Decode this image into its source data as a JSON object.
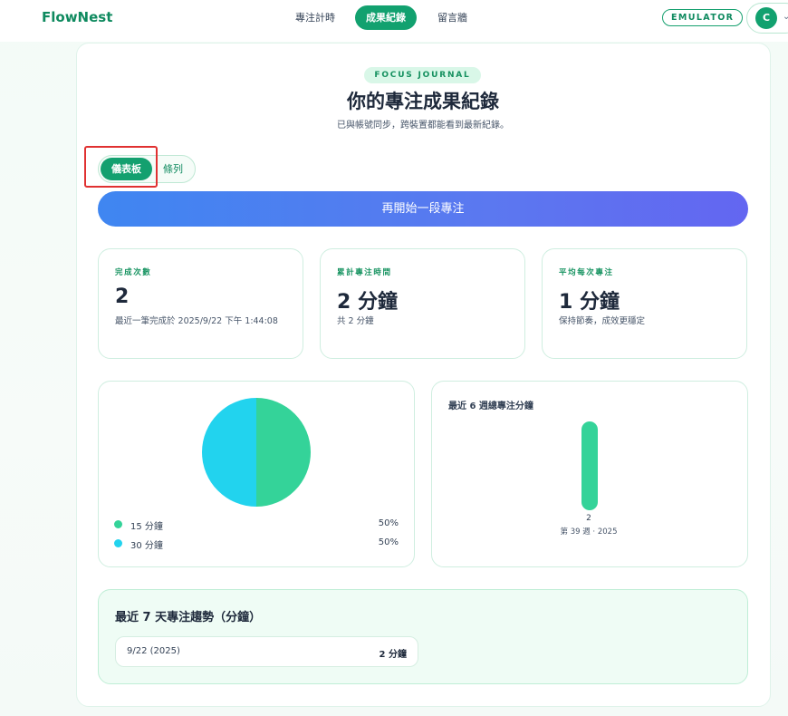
{
  "app": {
    "brand": "FlowNest"
  },
  "nav": {
    "items": [
      {
        "label": "專注計時"
      },
      {
        "label": "成果紀錄"
      },
      {
        "label": "留言牆"
      }
    ],
    "emulator_badge": "EMULATOR",
    "avatar_initial": "C"
  },
  "header": {
    "eyebrow": "FOCUS JOURNAL",
    "title": "你的專注成果紀錄",
    "subtitle": "已與帳號同步，跨裝置都能看到最新紀錄。"
  },
  "view_toggle": {
    "options": [
      "儀表板",
      "條列"
    ],
    "selected": "儀表板"
  },
  "cta": {
    "label": "再開始一段專注"
  },
  "stats": [
    {
      "label": "完成次數",
      "value": "2",
      "note": "最近一筆完成於 2025/9/22 下午 1:44:08"
    },
    {
      "label": "累計專注時間",
      "value": "2 分鐘",
      "note": "共 2 分鐘"
    },
    {
      "label": "平均每次專注",
      "value": "1 分鐘",
      "note": "保持節奏，成效更穩定"
    }
  ],
  "distribution": {
    "legend": [
      {
        "name": "15 分鐘",
        "percent": "50%",
        "color": "#34d399"
      },
      {
        "name": "30 分鐘",
        "percent": "50%",
        "color": "#22d3ee"
      }
    ]
  },
  "weekly": {
    "title": "最近 6 週總專注分鐘",
    "weeks": [
      {
        "value": "2",
        "label": "第 39 週 · 2025"
      }
    ]
  },
  "trend": {
    "title": "最近 7 天專注趨勢（分鐘）",
    "rows": [
      {
        "date": "9/22 (2025)",
        "minutes": "2 分鐘"
      }
    ]
  },
  "chart_data": [
    {
      "type": "pie",
      "categories": [
        "15 分鐘",
        "30 分鐘"
      ],
      "values": [
        50,
        50
      ],
      "colors": [
        "#34d399",
        "#22d3ee"
      ],
      "legend": "bottom"
    },
    {
      "type": "bar",
      "title": "最近 6 週總專注分鐘",
      "categories": [
        "第 39 週 · 2025"
      ],
      "values": [
        2
      ],
      "color": "#34d399"
    }
  ]
}
